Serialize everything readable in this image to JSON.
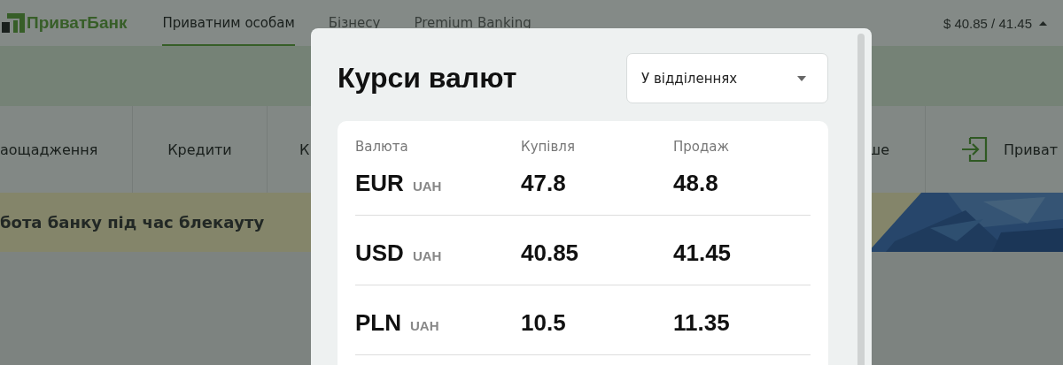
{
  "header": {
    "logo": "ПриватБанк",
    "nav": [
      {
        "label": "Приватним особам",
        "selected": true
      },
      {
        "label": "Бізнесу",
        "selected": false
      },
      {
        "label": "Premium Banking",
        "selected": false
      }
    ],
    "rate": "$ 40.85 / 41.45"
  },
  "categories": [
    "аощадження",
    "Кредити",
    "К",
    "ше"
  ],
  "login_link": "Приват",
  "banner": {
    "text": "бота банку під час блекауту",
    "kind": "picture"
  },
  "modal": {
    "title": "Курси валют",
    "source": "У відділеннях",
    "columns": [
      "Валюта",
      "Купівля",
      "Продаж"
    ],
    "rows": [
      {
        "currency": "EUR",
        "base": "UAH",
        "buy": "47.8",
        "sell": "48.8"
      },
      {
        "currency": "USD",
        "base": "UAH",
        "buy": "40.85",
        "sell": "41.45"
      },
      {
        "currency": "PLN",
        "base": "UAH",
        "buy": "10.5",
        "sell": "11.35"
      }
    ]
  }
}
